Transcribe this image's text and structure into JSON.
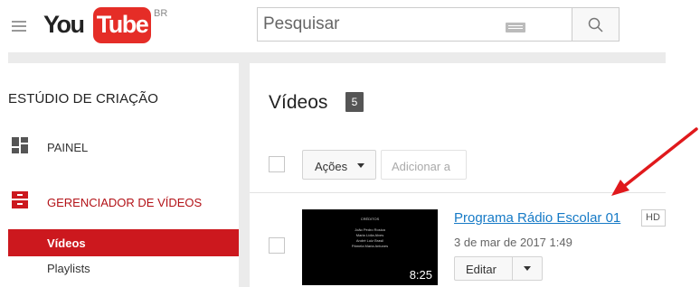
{
  "header": {
    "logo_you": "You",
    "logo_tube": "Tube",
    "region": "BR",
    "search_placeholder": "Pesquisar"
  },
  "sidebar": {
    "title": "ESTÚDIO DE CRIAÇÃO",
    "items": [
      {
        "label": "PAINEL",
        "icon": "dashboard-icon"
      },
      {
        "label": "GERENCIADOR DE VÍDEOS",
        "icon": "video-manager-icon",
        "color": "#b31217"
      }
    ],
    "sub_items": [
      {
        "label": "Vídeos",
        "selected": true
      },
      {
        "label": "Playlists",
        "selected": false
      }
    ]
  },
  "main": {
    "title": "Vídeos",
    "count": "5",
    "actions_label": "Ações",
    "add_to_label": "Adicionar a",
    "videos": [
      {
        "title": "Programa Rádio Escolar 01",
        "quality_badge": "HD",
        "date": "3 de mar de 2017 1:49",
        "duration": "8:25",
        "edit_label": "Editar",
        "thumbnail_credits": {
          "heading": "CRÉDITOS",
          "names": [
            "João Pedro Rosica",
            "Maria Lídia Alves",
            "André Luiz Brasil",
            "Pâmela Maria Antunes"
          ]
        }
      }
    ]
  },
  "colors": {
    "brand_red": "#e52d27",
    "selected_nav": "#cc181e",
    "link_blue": "#167ac6",
    "arrow_red": "#e0191c"
  }
}
